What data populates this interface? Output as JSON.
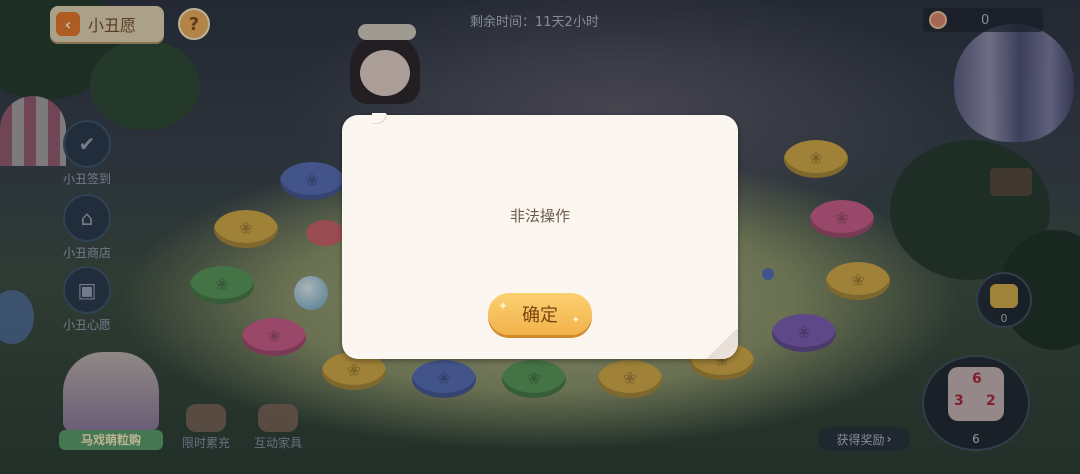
{
  "header": {
    "back_icon": "arrow-left-icon",
    "title": "小丑愿",
    "help_label": "?",
    "timer": "剩余时间：11天2小时",
    "coin_icon": "candy-icon",
    "coin_count": "0"
  },
  "sidebar": {
    "items": [
      {
        "label": "小丑签到",
        "icon": "calendar-check-icon"
      },
      {
        "label": "小丑商店",
        "icon": "shop-icon"
      },
      {
        "label": "小丑心愿",
        "icon": "wish-book-icon"
      }
    ]
  },
  "bottom": {
    "promo_label": "马戏萌粒购",
    "items": [
      {
        "label": "限时累充",
        "icon": "limited-recharge-icon"
      },
      {
        "label": "互动家具",
        "icon": "furniture-icon"
      }
    ],
    "reward_label": "获得奖励",
    "reward_arrow": "›"
  },
  "right": {
    "gift_count": "0",
    "dice_count": "6"
  },
  "dialog": {
    "message": "非法操作",
    "confirm_label": "确定"
  },
  "colors": {
    "confirm_button": "#f5bd55",
    "dialog_bg": "#fbf6f0",
    "back_icon": "#ee7b28"
  }
}
